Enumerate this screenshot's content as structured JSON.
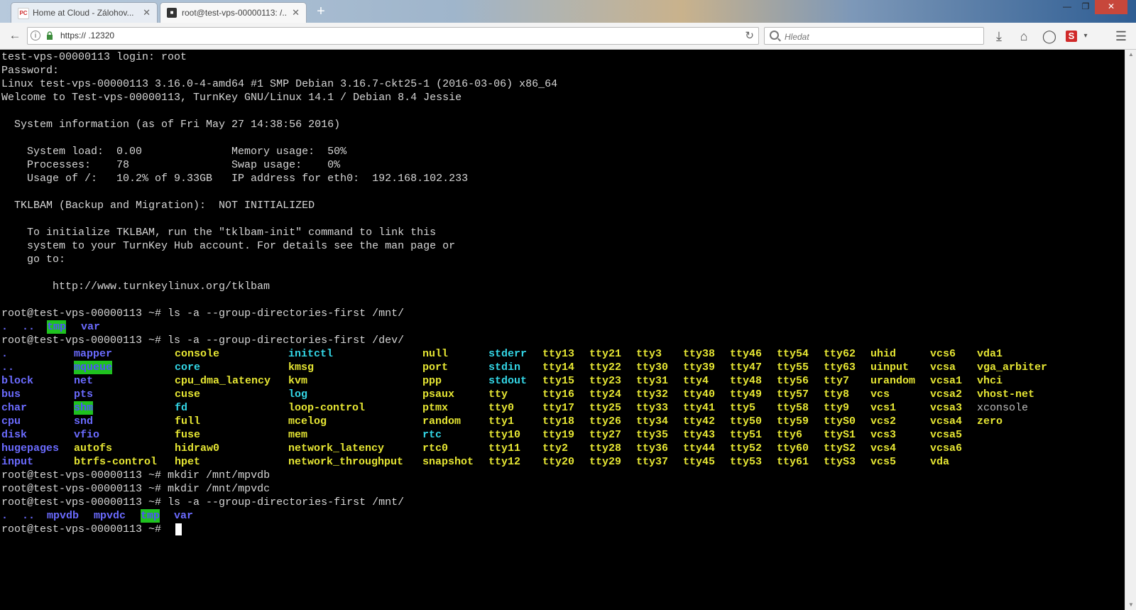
{
  "browser": {
    "tabs": [
      {
        "title": "Home at Cloud - Zálohov...",
        "favicon": "cloud-favicon",
        "active": false
      },
      {
        "title": "root@test-vps-00000113: /...",
        "favicon": "terminal-favicon",
        "active": true
      }
    ],
    "url": "https://                        .12320",
    "search_placeholder": "Hledat",
    "icons": [
      "back-arrow-icon",
      "info-icon",
      "lock-icon",
      "reload-icon",
      "search-icon",
      "download-icon",
      "home-icon",
      "chat-icon",
      "s-extension-icon",
      "dropdown-icon",
      "menu-icon"
    ]
  },
  "terminal": {
    "prompt": "root@test-vps-00000113 ~# ",
    "lines": [
      "test-vps-00000113 login: root",
      "Password:",
      "Linux test-vps-00000113 3.16.0-4-amd64 #1 SMP Debian 3.16.7-ckt25-1 (2016-03-06) x86_64",
      "Welcome to Test-vps-00000113, TurnKey GNU/Linux 14.1 / Debian 8.4 Jessie",
      "",
      "  System information (as of Fri May 27 14:38:56 2016)",
      "",
      "    System load:  0.00              Memory usage:  50%",
      "    Processes:    78                Swap usage:    0%",
      "    Usage of /:   10.2% of 9.33GB   IP address for eth0:  192.168.102.233",
      "",
      "  TKLBAM (Backup and Migration):  NOT INITIALIZED",
      "",
      "    To initialize TKLBAM, run the \"tklbam-init\" command to link this",
      "    system to your TurnKey Hub account. For details see the man page or",
      "    go to:",
      "",
      "        http://www.turnkeylinux.org/tklbam",
      ""
    ],
    "cmd1": "ls -a --group-directories-first /mnt/",
    "mnt1": [
      {
        "t": ".",
        "c": "dir"
      },
      {
        "t": "..",
        "c": "dir"
      },
      {
        "t": "tmp",
        "c": "dirhl"
      },
      {
        "t": "var",
        "c": "dir"
      }
    ],
    "cmd2": "ls -a --group-directories-first /dev/",
    "dev_columns": [
      [
        {
          "t": ".",
          "c": "dir"
        },
        {
          "t": "..",
          "c": "dir"
        },
        {
          "t": "block",
          "c": "dir"
        },
        {
          "t": "bus",
          "c": "dir"
        },
        {
          "t": "char",
          "c": "dir"
        },
        {
          "t": "cpu",
          "c": "dir"
        },
        {
          "t": "disk",
          "c": "dir"
        },
        {
          "t": "hugepages",
          "c": "dir"
        },
        {
          "t": "input",
          "c": "dir"
        }
      ],
      [
        {
          "t": "mapper",
          "c": "dir"
        },
        {
          "t": "mqueue",
          "c": "dirhl"
        },
        {
          "t": "net",
          "c": "dir"
        },
        {
          "t": "pts",
          "c": "dir"
        },
        {
          "t": "shm",
          "c": "dirhl"
        },
        {
          "t": "snd",
          "c": "dir"
        },
        {
          "t": "vfio",
          "c": "dir"
        },
        {
          "t": "autofs",
          "c": "dev"
        },
        {
          "t": "btrfs-control",
          "c": "dev"
        }
      ],
      [
        {
          "t": "console",
          "c": "dev"
        },
        {
          "t": "core",
          "c": "lnk"
        },
        {
          "t": "cpu_dma_latency",
          "c": "dev"
        },
        {
          "t": "cuse",
          "c": "dev"
        },
        {
          "t": "fd",
          "c": "lnk"
        },
        {
          "t": "full",
          "c": "dev"
        },
        {
          "t": "fuse",
          "c": "dev"
        },
        {
          "t": "hidraw0",
          "c": "dev"
        },
        {
          "t": "hpet",
          "c": "dev"
        }
      ],
      [
        {
          "t": "initctl",
          "c": "lnk"
        },
        {
          "t": "kmsg",
          "c": "dev"
        },
        {
          "t": "kvm",
          "c": "dev"
        },
        {
          "t": "log",
          "c": "lnk"
        },
        {
          "t": "loop-control",
          "c": "dev"
        },
        {
          "t": "mcelog",
          "c": "dev"
        },
        {
          "t": "mem",
          "c": "dev"
        },
        {
          "t": "network_latency",
          "c": "dev"
        },
        {
          "t": "network_throughput",
          "c": "dev"
        }
      ],
      [
        {
          "t": "null",
          "c": "dev"
        },
        {
          "t": "port",
          "c": "dev"
        },
        {
          "t": "ppp",
          "c": "dev"
        },
        {
          "t": "psaux",
          "c": "dev"
        },
        {
          "t": "ptmx",
          "c": "dev"
        },
        {
          "t": "random",
          "c": "dev"
        },
        {
          "t": "rtc",
          "c": "lnk"
        },
        {
          "t": "rtc0",
          "c": "dev"
        },
        {
          "t": "snapshot",
          "c": "dev"
        }
      ],
      [
        {
          "t": "stderr",
          "c": "lnk"
        },
        {
          "t": "stdin",
          "c": "lnk"
        },
        {
          "t": "stdout",
          "c": "lnk"
        },
        {
          "t": "tty",
          "c": "dev"
        },
        {
          "t": "tty0",
          "c": "dev"
        },
        {
          "t": "tty1",
          "c": "dev"
        },
        {
          "t": "tty10",
          "c": "dev"
        },
        {
          "t": "tty11",
          "c": "dev"
        },
        {
          "t": "tty12",
          "c": "dev"
        }
      ],
      [
        {
          "t": "tty13",
          "c": "dev"
        },
        {
          "t": "tty14",
          "c": "dev"
        },
        {
          "t": "tty15",
          "c": "dev"
        },
        {
          "t": "tty16",
          "c": "dev"
        },
        {
          "t": "tty17",
          "c": "dev"
        },
        {
          "t": "tty18",
          "c": "dev"
        },
        {
          "t": "tty19",
          "c": "dev"
        },
        {
          "t": "tty2",
          "c": "dev"
        },
        {
          "t": "tty20",
          "c": "dev"
        }
      ],
      [
        {
          "t": "tty21",
          "c": "dev"
        },
        {
          "t": "tty22",
          "c": "dev"
        },
        {
          "t": "tty23",
          "c": "dev"
        },
        {
          "t": "tty24",
          "c": "dev"
        },
        {
          "t": "tty25",
          "c": "dev"
        },
        {
          "t": "tty26",
          "c": "dev"
        },
        {
          "t": "tty27",
          "c": "dev"
        },
        {
          "t": "tty28",
          "c": "dev"
        },
        {
          "t": "tty29",
          "c": "dev"
        }
      ],
      [
        {
          "t": "tty3",
          "c": "dev"
        },
        {
          "t": "tty30",
          "c": "dev"
        },
        {
          "t": "tty31",
          "c": "dev"
        },
        {
          "t": "tty32",
          "c": "dev"
        },
        {
          "t": "tty33",
          "c": "dev"
        },
        {
          "t": "tty34",
          "c": "dev"
        },
        {
          "t": "tty35",
          "c": "dev"
        },
        {
          "t": "tty36",
          "c": "dev"
        },
        {
          "t": "tty37",
          "c": "dev"
        }
      ],
      [
        {
          "t": "tty38",
          "c": "dev"
        },
        {
          "t": "tty39",
          "c": "dev"
        },
        {
          "t": "tty4",
          "c": "dev"
        },
        {
          "t": "tty40",
          "c": "dev"
        },
        {
          "t": "tty41",
          "c": "dev"
        },
        {
          "t": "tty42",
          "c": "dev"
        },
        {
          "t": "tty43",
          "c": "dev"
        },
        {
          "t": "tty44",
          "c": "dev"
        },
        {
          "t": "tty45",
          "c": "dev"
        }
      ],
      [
        {
          "t": "tty46",
          "c": "dev"
        },
        {
          "t": "tty47",
          "c": "dev"
        },
        {
          "t": "tty48",
          "c": "dev"
        },
        {
          "t": "tty49",
          "c": "dev"
        },
        {
          "t": "tty5",
          "c": "dev"
        },
        {
          "t": "tty50",
          "c": "dev"
        },
        {
          "t": "tty51",
          "c": "dev"
        },
        {
          "t": "tty52",
          "c": "dev"
        },
        {
          "t": "tty53",
          "c": "dev"
        }
      ],
      [
        {
          "t": "tty54",
          "c": "dev"
        },
        {
          "t": "tty55",
          "c": "dev"
        },
        {
          "t": "tty56",
          "c": "dev"
        },
        {
          "t": "tty57",
          "c": "dev"
        },
        {
          "t": "tty58",
          "c": "dev"
        },
        {
          "t": "tty59",
          "c": "dev"
        },
        {
          "t": "tty6",
          "c": "dev"
        },
        {
          "t": "tty60",
          "c": "dev"
        },
        {
          "t": "tty61",
          "c": "dev"
        }
      ],
      [
        {
          "t": "tty62",
          "c": "dev"
        },
        {
          "t": "tty63",
          "c": "dev"
        },
        {
          "t": "tty7",
          "c": "dev"
        },
        {
          "t": "tty8",
          "c": "dev"
        },
        {
          "t": "tty9",
          "c": "dev"
        },
        {
          "t": "ttyS0",
          "c": "dev"
        },
        {
          "t": "ttyS1",
          "c": "dev"
        },
        {
          "t": "ttyS2",
          "c": "dev"
        },
        {
          "t": "ttyS3",
          "c": "dev"
        }
      ],
      [
        {
          "t": "uhid",
          "c": "dev"
        },
        {
          "t": "uinput",
          "c": "dev"
        },
        {
          "t": "urandom",
          "c": "dev"
        },
        {
          "t": "vcs",
          "c": "dev"
        },
        {
          "t": "vcs1",
          "c": "dev"
        },
        {
          "t": "vcs2",
          "c": "dev"
        },
        {
          "t": "vcs3",
          "c": "dev"
        },
        {
          "t": "vcs4",
          "c": "dev"
        },
        {
          "t": "vcs5",
          "c": "dev"
        }
      ],
      [
        {
          "t": "vcs6",
          "c": "dev"
        },
        {
          "t": "vcsa",
          "c": "dev"
        },
        {
          "t": "vcsa1",
          "c": "dev"
        },
        {
          "t": "vcsa2",
          "c": "dev"
        },
        {
          "t": "vcsa3",
          "c": "dev"
        },
        {
          "t": "vcsa4",
          "c": "dev"
        },
        {
          "t": "vcsa5",
          "c": "dev"
        },
        {
          "t": "vcsa6",
          "c": "dev"
        },
        {
          "t": "vda",
          "c": "dev"
        }
      ],
      [
        {
          "t": "vda1",
          "c": "dev"
        },
        {
          "t": "vga_arbiter",
          "c": "dev"
        },
        {
          "t": "vhci",
          "c": "dev"
        },
        {
          "t": "vhost-net",
          "c": "dev"
        },
        {
          "t": "xconsole",
          "c": "plain"
        },
        {
          "t": "zero",
          "c": "dev"
        }
      ]
    ],
    "cmd3": "mkdir /mnt/mpvdb",
    "cmd4": "mkdir /mnt/mpvdc",
    "cmd5": "ls -a --group-directories-first /mnt/",
    "mnt2": [
      {
        "t": ".",
        "c": "dir"
      },
      {
        "t": "..",
        "c": "dir"
      },
      {
        "t": "mpvdb",
        "c": "dir"
      },
      {
        "t": "mpvdc",
        "c": "dir"
      },
      {
        "t": "tmp",
        "c": "dirhl"
      },
      {
        "t": "var",
        "c": "dir"
      }
    ]
  }
}
